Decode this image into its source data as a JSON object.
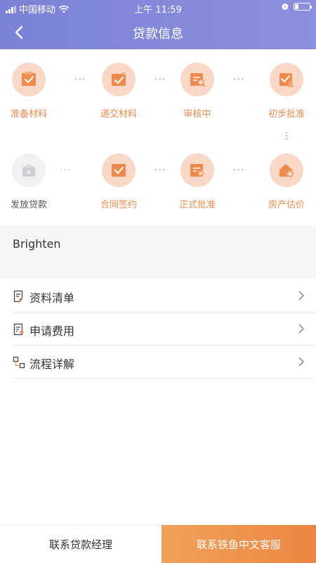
{
  "status_bar": {
    "carrier": "中国移动",
    "time": "上午 11:59"
  },
  "nav": {
    "title": "贷款信息"
  },
  "steps": [
    {
      "label": "准备材料",
      "state": "active",
      "icon": "clipboard-check-icon"
    },
    {
      "label": "递交材料",
      "state": "active",
      "icon": "document-submit-icon"
    },
    {
      "label": "审核中",
      "state": "active",
      "icon": "document-review-icon"
    },
    {
      "label": "初步批准",
      "state": "active",
      "icon": "document-approve-icon"
    },
    {
      "label": "房产估价",
      "state": "active",
      "icon": "house-valuation-icon"
    },
    {
      "label": "正式批准",
      "state": "active",
      "icon": "document-approved-icon"
    },
    {
      "label": "合同签约",
      "state": "active",
      "icon": "contract-sign-icon"
    },
    {
      "label": "发放贷款",
      "state": "inactive",
      "icon": "money-bag-icon"
    }
  ],
  "profile": {
    "name": "Brighten"
  },
  "menu": {
    "items": [
      {
        "label": "资料清单",
        "icon": "document-list-icon"
      },
      {
        "label": "申请费用",
        "icon": "fee-document-icon"
      },
      {
        "label": "流程详解",
        "icon": "flowchart-icon"
      }
    ]
  },
  "bottom": {
    "left_label": "联系贷款经理",
    "right_label": "联系铁鱼中文客服"
  },
  "colors": {
    "header": "#7f85d9",
    "accent": "#ef8a4c",
    "step_bg": "#f9d8c7",
    "inactive_bg": "#f1f1f3"
  }
}
